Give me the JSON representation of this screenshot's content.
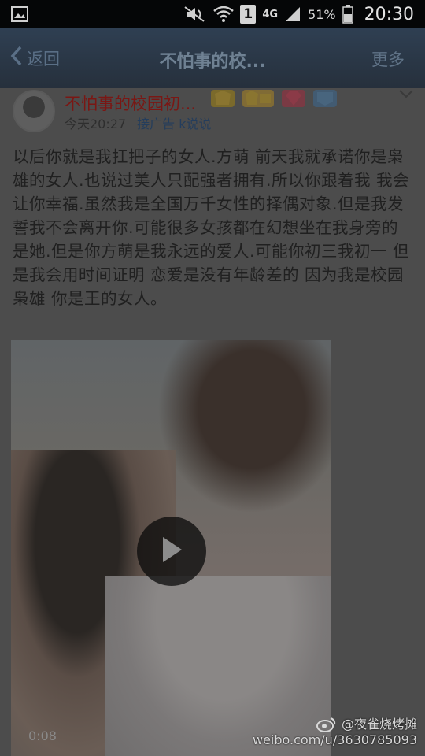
{
  "status_bar": {
    "network": "4G",
    "sim": "1",
    "battery": "51%",
    "time": "20:30",
    "icons": [
      "gallery-icon",
      "mute-icon",
      "wifi-icon",
      "sim-icon",
      "signal-icon",
      "battery-icon"
    ]
  },
  "nav": {
    "back_label": "返回",
    "title": "不怕事的校...",
    "more_label": "更多"
  },
  "post": {
    "author": "不怕事的校园初...",
    "time": "今天20:27",
    "source": "接广告 k说说",
    "badges": [
      "vip",
      "年",
      "diamond",
      "vip-level"
    ],
    "text": "以后你就是我扛把子的女人.方萌 前天我就承诺你是枭雄的女人.也说过美人只配强者拥有.所以你跟着我 我会让你幸福.虽然我是全国万千女性的择偶对象.但是我发誓我不会离开你.可能很多女孩都在幻想坐在我身旁的是她.但是你方萌是我永远的爱人.可能你初三我初一 但是我会用时间证明 恋爱是没有年龄差的 因为我是校园枭雄 你是王的女人。",
    "video": {
      "duration": "0:08"
    }
  },
  "watermark": {
    "line1": "@夜雀烧烤摊",
    "line2": "weibo.com/u/3630785093"
  }
}
